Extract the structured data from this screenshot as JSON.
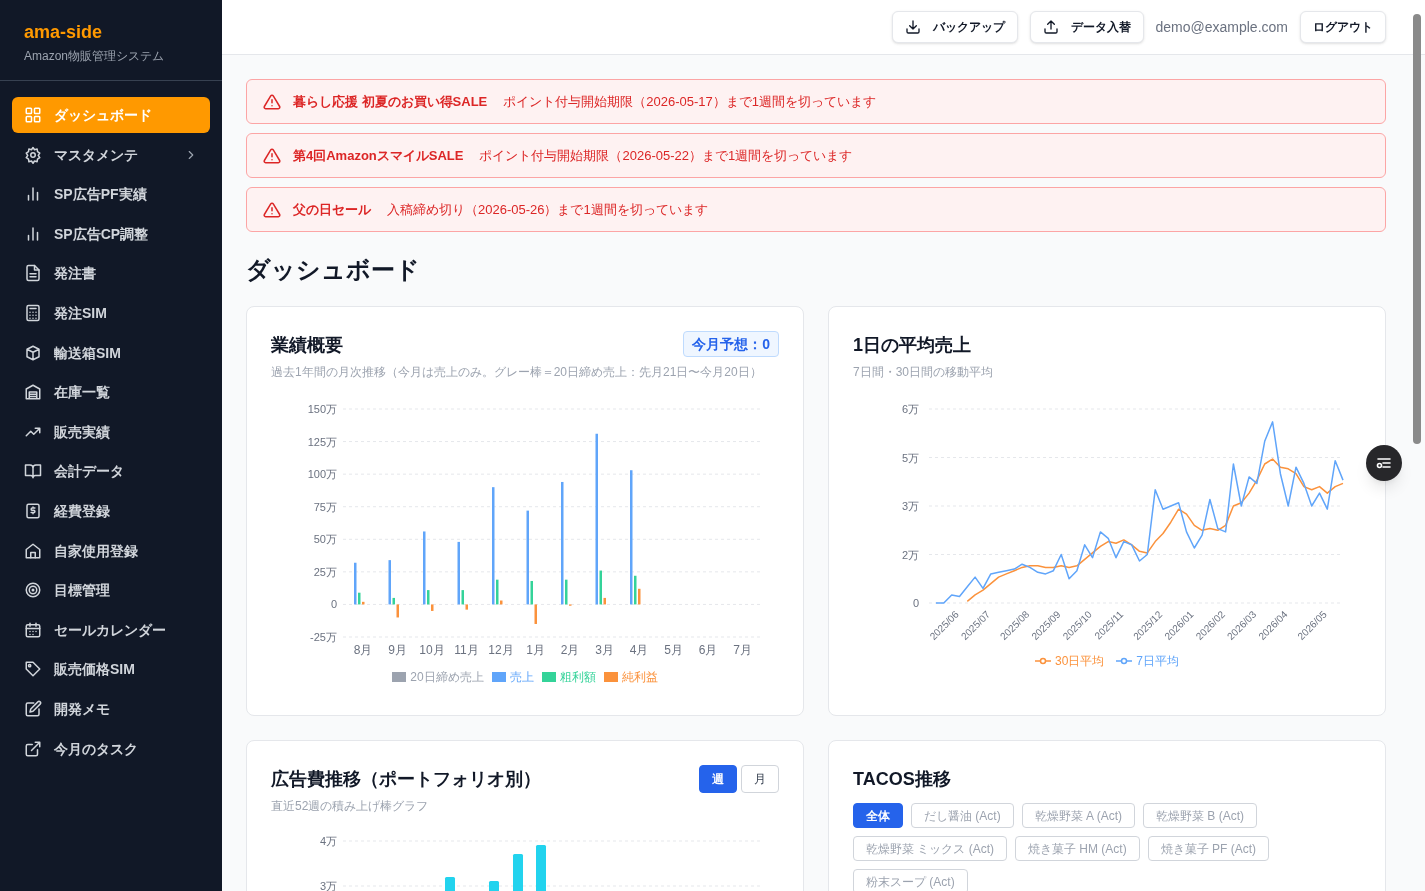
{
  "sidebar": {
    "logo": "ama-side",
    "subtitle": "Amazon物販管理システム",
    "items": [
      {
        "label": "ダッシュボード",
        "kind": "link",
        "selected": true
      },
      {
        "label": "マスタメンテ",
        "kind": "group",
        "selected": false,
        "expanded": false
      },
      {
        "label": "SP広告PF実績",
        "kind": "link",
        "selected": false
      },
      {
        "label": "SP広告CP調整",
        "kind": "link",
        "selected": false
      },
      {
        "label": "発注書",
        "kind": "link",
        "selected": false
      },
      {
        "label": "発注SIM",
        "kind": "link",
        "selected": false
      },
      {
        "label": "輸送箱SIM",
        "kind": "link",
        "selected": false
      },
      {
        "label": "在庫一覧",
        "kind": "link",
        "selected": false
      },
      {
        "label": "販売実績",
        "kind": "link",
        "selected": false
      },
      {
        "label": "会計データ",
        "kind": "link",
        "selected": false
      },
      {
        "label": "経費登録",
        "kind": "link",
        "selected": false
      },
      {
        "label": "自家使用登録",
        "kind": "link",
        "selected": false
      },
      {
        "label": "目標管理",
        "kind": "link",
        "selected": false
      },
      {
        "label": "セールカレンダー",
        "kind": "link",
        "selected": false
      },
      {
        "label": "販売価格SIM",
        "kind": "link",
        "selected": false
      },
      {
        "label": "開発メモ",
        "kind": "link",
        "selected": false
      },
      {
        "label": "今月のタスク",
        "kind": "external",
        "selected": false
      }
    ]
  },
  "header": {
    "buttons": [
      {
        "label": "バックアップ",
        "kind": "download"
      },
      {
        "label": "データ入替",
        "kind": "upload"
      }
    ],
    "user_email": "demo@example.com",
    "logout": "ログアウト"
  },
  "alerts": [
    {
      "title": "暮らし応援 初夏のお買い得SALE",
      "message": "ポイント付与開始期限（2026-05-17）まで1週間を切っています"
    },
    {
      "title": "第4回AmazonスマイルSALE",
      "message": "ポイント付与開始期限（2026-05-22）まで1週間を切っています"
    },
    {
      "title": "父の日セール",
      "message": "入稿締め切り（2026-05-26）まで1週間を切っています"
    }
  ],
  "page_title": "ダッシュボード",
  "performance_card": {
    "title": "業績概要",
    "badge": "今月予想：0",
    "subtitle": "過去1年間の月次推移（今月は売上のみ。グレー棒＝20日締め売上：先月21日〜今月20日）",
    "chart_data": {
      "type": "bar",
      "grid": true,
      "legend": "bottom",
      "categories": [
        "8月",
        "9月",
        "10月",
        "11月",
        "12月",
        "1月",
        "2月",
        "3月",
        "4月",
        "5月",
        "6月",
        "7月"
      ],
      "ylim": [
        -25,
        150
      ],
      "yticks": [
        {
          "value": -25,
          "label": "-25万"
        },
        {
          "value": 0,
          "label": "0"
        },
        {
          "value": 25,
          "label": "25万"
        },
        {
          "value": 50,
          "label": "50万"
        },
        {
          "value": 75,
          "label": "75万"
        },
        {
          "value": 100,
          "label": "100万"
        },
        {
          "value": 125,
          "label": "125万"
        },
        {
          "value": 150,
          "label": "150万"
        }
      ],
      "series": [
        {
          "name": "20日締め売上",
          "color": "#9ca3af",
          "values": [
            null,
            null,
            null,
            null,
            null,
            null,
            null,
            null,
            null,
            null,
            null,
            null
          ]
        },
        {
          "name": "売上",
          "color": "#60a5fa",
          "values": [
            32,
            34,
            56,
            48,
            90,
            72,
            94,
            131,
            103,
            null,
            null,
            null
          ]
        },
        {
          "name": "粗利額",
          "color": "#34d399",
          "values": [
            9,
            5,
            11,
            11,
            19,
            18,
            19,
            26,
            22,
            null,
            null,
            null
          ]
        },
        {
          "name": "純利益",
          "color": "#fb923c",
          "values": [
            2,
            -10,
            -5,
            -4,
            3,
            -15,
            -1,
            5,
            12,
            null,
            null,
            null
          ]
        }
      ]
    }
  },
  "daily_sales_card": {
    "title": "1日の平均売上",
    "subtitle": "7日間・30日間の移動平均",
    "chart_data": {
      "type": "line",
      "grid": true,
      "legend": "bottom",
      "ylim": [
        0,
        6
      ],
      "yticks": [
        {
          "value": 0,
          "label": "0"
        },
        {
          "value": 1.5,
          "label": "2万"
        },
        {
          "value": 3,
          "label": "3万"
        },
        {
          "value": 4.5,
          "label": "5万"
        },
        {
          "value": 6,
          "label": "6万"
        }
      ],
      "categories": [
        null,
        null,
        null,
        "2025/06",
        null,
        null,
        null,
        "2025/07",
        null,
        null,
        null,
        null,
        "2025/08",
        null,
        null,
        null,
        "2025/09",
        null,
        null,
        null,
        "2025/10",
        null,
        null,
        null,
        "2025/11",
        null,
        null,
        null,
        null,
        "2025/12",
        null,
        null,
        null,
        "2026/01",
        null,
        null,
        null,
        "2026/02",
        null,
        null,
        null,
        "2026/03",
        null,
        null,
        null,
        "2026/04",
        null,
        null,
        null,
        null,
        "2026/05",
        null,
        null
      ],
      "series": [
        {
          "name": "30日平均",
          "color": "#fb923c",
          "values": [
            null,
            null,
            null,
            null,
            0.05,
            0.25,
            0.4,
            0.6,
            0.8,
            0.9,
            1,
            1.1,
            1.15,
            1.15,
            1.1,
            1.1,
            1.15,
            1.1,
            1.15,
            1.35,
            1.55,
            1.75,
            1.9,
            1.85,
            1.95,
            1.8,
            1.6,
            1.55,
            1.9,
            2.15,
            2.5,
            2.9,
            2.75,
            2.4,
            2.25,
            2.3,
            2.25,
            2.4,
            3,
            3.1,
            3.4,
            3.8,
            4.3,
            4.45,
            4.2,
            4.15,
            4,
            3.6,
            3.5,
            3.6,
            3.4,
            3.6,
            3.7
          ]
        },
        {
          "name": "7日平均",
          "color": "#60a5fa",
          "values": [
            0,
            0,
            0.25,
            0.2,
            0.5,
            0.8,
            0.45,
            0.9,
            0.95,
            1,
            1.05,
            1.2,
            1.1,
            0.95,
            0.9,
            1,
            1.5,
            0.75,
            1,
            1.8,
            1.4,
            2.2,
            2,
            1.4,
            1.9,
            1.8,
            1.3,
            1.5,
            3.5,
            2.9,
            3,
            3.1,
            2.2,
            1.7,
            2.1,
            3.2,
            2.3,
            2.2,
            4.3,
            3,
            3.9,
            3.7,
            5,
            5.6,
            4,
            3,
            4.2,
            3.7,
            3,
            3.4,
            2.9,
            4.4,
            3.8
          ]
        }
      ]
    }
  },
  "ad_cost_card": {
    "title": "広告費推移（ポートフォリオ別）",
    "subtitle": "直近52週の積み上げ棒グラフ",
    "toggles": [
      {
        "label": "週",
        "selected": true
      },
      {
        "label": "月",
        "selected": false
      }
    ],
    "y_axis_labels": [
      "4万",
      "3万"
    ]
  },
  "tacos_card": {
    "title": "TACOS推移",
    "filters": [
      {
        "label": "全体",
        "selected": true
      },
      {
        "label": "だし醤油 (Act)",
        "selected": false
      },
      {
        "label": "乾燥野菜 A (Act)",
        "selected": false
      },
      {
        "label": "乾燥野菜 B (Act)",
        "selected": false
      },
      {
        "label": "乾燥野菜 ミックス (Act)",
        "selected": false
      },
      {
        "label": "焼き菓子 HM (Act)",
        "selected": false
      },
      {
        "label": "焼き菓子 PF (Act)",
        "selected": false
      },
      {
        "label": "粉末スープ (Act)",
        "selected": false
      }
    ]
  }
}
